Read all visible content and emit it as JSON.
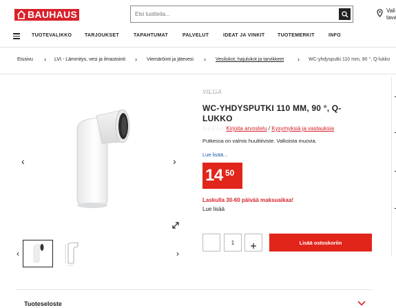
{
  "header": {
    "logo_text": "BAUHAUS",
    "search": {
      "placeholder": "Etsi tuotteita..."
    },
    "store_label_line1": "Vali",
    "store_label_line2": "tava"
  },
  "nav": {
    "items": [
      "TUOTEVALIKKO",
      "TARJOUKSET",
      "TAPAHTUMAT",
      "PALVELUT",
      "IDEAT JA VINKIT",
      "TUOTEMERKIT",
      "INFO"
    ]
  },
  "breadcrumb": {
    "items": [
      "Etusivu",
      "LVI - Lämmitys, vesi ja ilmastointi",
      "Viemäröinti ja jätevesi",
      "Vesilukot, hajulukot ja tarvikkeet",
      "WC-yhdysputki 110 mm, 90 °, Q-lukko"
    ]
  },
  "product": {
    "brand": "VIEGA",
    "title": "WC-YHDYSPUTKI 110 MM, 90 °, Q-LUKKO",
    "stars": "☆☆☆☆☆",
    "review_link": "Kirjoita arvostelu",
    "separator": "/",
    "questions_link": "Kysymyksiä ja vastauksia",
    "description": "Putkessa on valmis huulitiiviste. Valkoista muovia.",
    "read_more": "Lue lisää...",
    "price_whole": "14",
    "price_cents": "50",
    "promo": "Laskulla 30-60 päivää maksuaikaa!",
    "promo_read_more": "Lue lisää",
    "quantity": "1",
    "add_to_cart": "Lisää ostoskoriin"
  },
  "accordion": {
    "title": "Tuoteseloste"
  },
  "colors": {
    "brand_red": "#e1251b",
    "link_blue": "#1a56a6"
  }
}
